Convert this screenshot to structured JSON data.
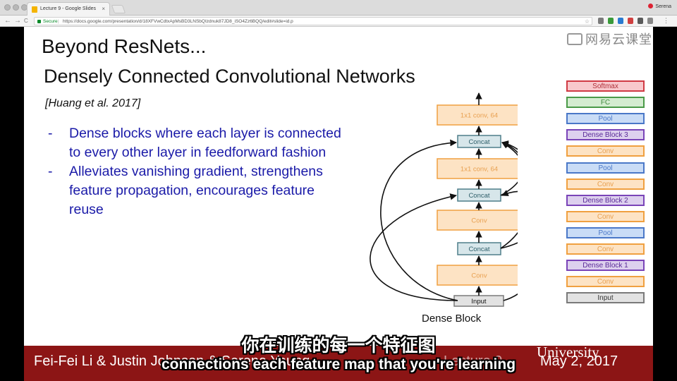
{
  "browser": {
    "tab_title": "Lecture 9 - Google Slides",
    "tab_close": "×",
    "user_name": "Serena",
    "secure_label": "Secure",
    "url": "https://docs.google.com/presentation/d/18XFVwCdtxApMsBD3LNSbQIzdnuk87JD8_iSO4Zz6BQQ/edit#slide=id.p",
    "back": "←",
    "forward": "→",
    "reload": "C",
    "star": "☆"
  },
  "watermark": "网易云课堂",
  "slide": {
    "title": "Beyond ResNets...",
    "subtitle": "Densely Connected Convolutional Networks",
    "citation": "[Huang et al. 2017]",
    "bullets": [
      {
        "dash": "-",
        "text": "Dense blocks where each layer is connected to every other layer in feedforward fashion"
      },
      {
        "dash": "-",
        "text": "Alleviates vanishing gradient, strengthens feature propagation, encourages feature reuse"
      }
    ]
  },
  "dense_block": {
    "caption": "Dense Block",
    "nodes": [
      "Input",
      "Conv",
      "Concat",
      "Conv",
      "Concat",
      "1x1 conv, 64",
      "Concat",
      "1x1 conv, 64"
    ]
  },
  "network_stack": [
    {
      "label": "Softmax",
      "kind": "softmax"
    },
    {
      "label": "FC",
      "kind": "fc"
    },
    {
      "label": "Pool",
      "kind": "pool"
    },
    {
      "label": "Dense Block 3",
      "kind": "dense"
    },
    {
      "label": "Conv",
      "kind": "conv"
    },
    {
      "label": "Pool",
      "kind": "pool"
    },
    {
      "label": "Conv",
      "kind": "conv"
    },
    {
      "label": "Dense Block 2",
      "kind": "dense"
    },
    {
      "label": "Conv",
      "kind": "conv"
    },
    {
      "label": "Pool",
      "kind": "pool"
    },
    {
      "label": "Conv",
      "kind": "conv"
    },
    {
      "label": "Dense Block 1",
      "kind": "dense"
    },
    {
      "label": "Conv",
      "kind": "conv"
    },
    {
      "label": "Input",
      "kind": "input"
    }
  ],
  "colors": {
    "softmax": {
      "bg": "#f8c8cc",
      "border": "#d03a44",
      "text": "#b0303a"
    },
    "fc": {
      "bg": "#d4ecd0",
      "border": "#4a9a48",
      "text": "#3f8a3d"
    },
    "pool": {
      "bg": "#c9dcf6",
      "border": "#4a78c8",
      "text": "#4a78c8"
    },
    "dense": {
      "bg": "#ddd0ee",
      "border": "#7a44b8",
      "text": "#5a2a98"
    },
    "conv": {
      "bg": "#fde3c4",
      "border": "#f0a040",
      "text": "#e8a050"
    },
    "input": {
      "bg": "#e2e2e2",
      "border": "#7a7a7a",
      "text": "#333333"
    },
    "concat": {
      "bg": "#d7e6ea",
      "border": "#4f7f8a",
      "text": "#2f5f6a"
    },
    "footer": "#8c1515"
  },
  "footer": {
    "authors": "Fei-Fei Li & Justin Johnson & Serena Yeung",
    "lecture": "Lecture 9 -",
    "date": "May 2, 2017",
    "university": "University"
  },
  "subtitles": {
    "chinese": "你在训练的每一个特征图",
    "english": "connections each feature map that you're learning"
  }
}
